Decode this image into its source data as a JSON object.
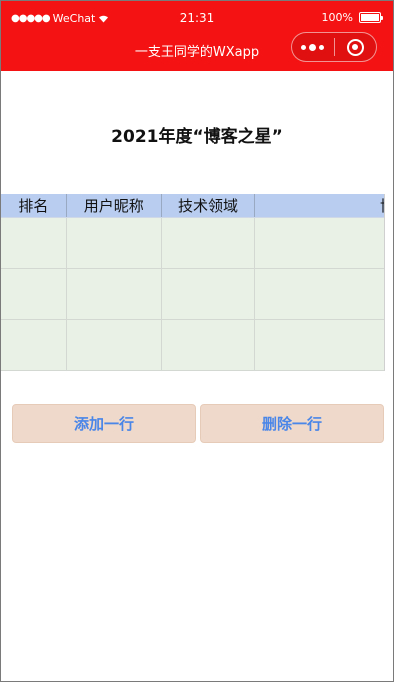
{
  "status_bar": {
    "signal_dots": "●●●●●",
    "carrier": "WeChat",
    "wifi_icon": "wifi-icon",
    "time": "21:31",
    "battery_level": "100%",
    "battery_fraction": 1.0
  },
  "nav_bar": {
    "title": "一支王同学的WXapp",
    "background_color": "#f51212",
    "capsule": {
      "more_icon": "more-dots-icon",
      "close_icon": "target-circle-icon"
    }
  },
  "page": {
    "title": "2021年度“博客之星”",
    "table": {
      "headers": [
        "排名",
        "用户昵称",
        "技术领域"
      ],
      "truncated_header_fragment": "博",
      "rows": [
        [
          "",
          "",
          "",
          ""
        ],
        [
          "",
          "",
          "",
          ""
        ],
        [
          "",
          "",
          "",
          ""
        ]
      ]
    },
    "buttons": {
      "add_row": "添加一行",
      "delete_row": "删除一行"
    }
  }
}
